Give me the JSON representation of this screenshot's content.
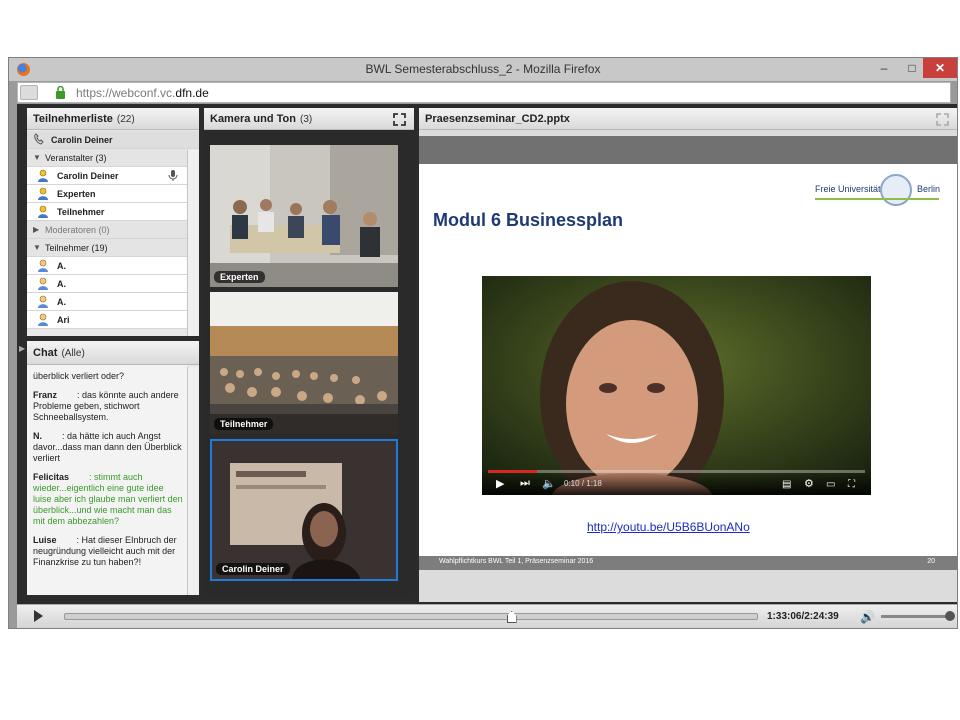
{
  "window": {
    "title": "BWL Semesterabschluss_2 - Mozilla Firefox",
    "minimize": "–",
    "maximize": "□",
    "close": "✕"
  },
  "urlbar": {
    "prefix": "https://webconf.vc.",
    "domain": "dfn.de"
  },
  "attendees": {
    "title": "Teilnehmerliste",
    "count": "(22)",
    "presenter": "Carolin Deiner",
    "groups": [
      {
        "label": "Veranstalter (3)",
        "members": [
          "Carolin Deiner",
          "Experten",
          "Teilnehmer"
        ]
      },
      {
        "label": "Moderatoren (0)",
        "members": []
      },
      {
        "label": "Teilnehmer (19)",
        "members": [
          "A.",
          "A.",
          "A.",
          "Ari"
        ]
      }
    ]
  },
  "chat": {
    "title": "Chat",
    "scope": "(Alle)",
    "messages": [
      {
        "name": "",
        "text": "überblick verliert oder?"
      },
      {
        "name": "Franz",
        "text": ": das könnte auch andere Probleme geben, stichwort Schneeballsystem."
      },
      {
        "name": "N.",
        "text": ": da hätte ich auch Angst davor...dass man dann den Überblick verliert"
      },
      {
        "name": "Felicitas",
        "text": ": stimmt auch wieder...eigentlich eine gute idee luise aber ich glaube man verliert den überblick...und wie macht man das mit dem abbezahlen?"
      },
      {
        "name": "Luise",
        "text": ": Hat dieser EInbruch der neugründung vielleicht auch mit der Finanzkrise zu tun haben?!"
      }
    ]
  },
  "camera": {
    "title": "Kamera und Ton",
    "count": "(3)",
    "feeds": [
      "Experten",
      "Teilnehmer",
      "Carolin Deiner"
    ]
  },
  "share": {
    "title": "Praesenzseminar_CD2.pptx",
    "slide_title": "Modul 6 Businessplan",
    "logo_left": "Freie Universität",
    "logo_right": "Berlin",
    "video_time": "0:10 / 1:18",
    "video_progress": 0.13,
    "link": "http://youtu.be/U5B6BUonANo",
    "footer_left": "Wahlpflichtkurs BWL Teil 1, Präsenzseminar 2016",
    "footer_right": "20"
  },
  "playback": {
    "time": "1:33:06/2:24:39",
    "progress": 0.645,
    "volume": 1.0
  },
  "colors": {
    "accent_blue": "#1f7ad8",
    "slide_title": "#1f3a73",
    "chat_green": "#3a9a2a",
    "youtube_red": "#d8271c"
  }
}
